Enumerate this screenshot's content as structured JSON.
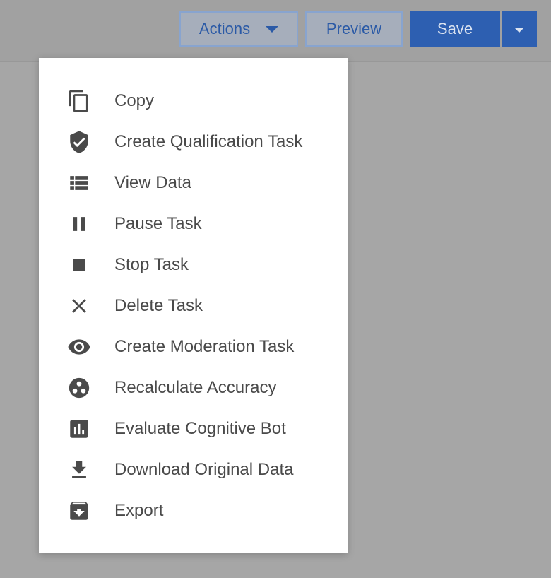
{
  "toolbar": {
    "actions_label": "Actions",
    "preview_label": "Preview",
    "save_label": "Save"
  },
  "menu": {
    "items": [
      {
        "label": "Copy",
        "icon": "copy-icon"
      },
      {
        "label": "Create Qualification Task",
        "icon": "shield-check-icon"
      },
      {
        "label": "View Data",
        "icon": "list-icon"
      },
      {
        "label": "Pause Task",
        "icon": "pause-icon"
      },
      {
        "label": "Stop Task",
        "icon": "stop-icon"
      },
      {
        "label": "Delete Task",
        "icon": "close-icon"
      },
      {
        "label": "Create Moderation Task",
        "icon": "eye-icon"
      },
      {
        "label": "Recalculate Accuracy",
        "icon": "bubble-chart-icon"
      },
      {
        "label": "Evaluate Cognitive Bot",
        "icon": "bar-chart-icon"
      },
      {
        "label": "Download Original Data",
        "icon": "download-icon"
      },
      {
        "label": "Export",
        "icon": "archive-icon"
      }
    ]
  },
  "colors": {
    "primary": "#2d5fb1",
    "icon": "#4a4a4a",
    "overlay": "#a6a6a6"
  }
}
